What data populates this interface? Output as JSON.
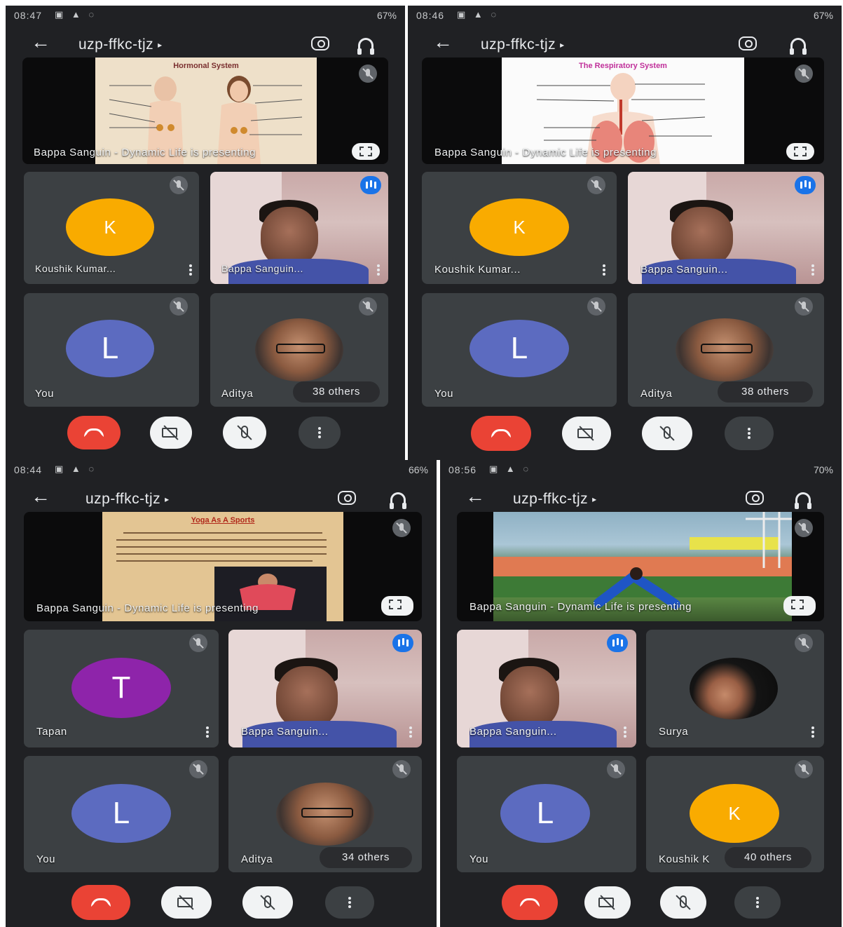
{
  "meeting": {
    "title": "uzp-ffkc-tjz",
    "presenter_caption": "Bappa Sanguin - Dynamic Life is presenting",
    "presenter_short": "Bappa Sanguin..."
  },
  "panels": [
    {
      "status": {
        "time": "08:47",
        "battery": "67%"
      },
      "slide": {
        "title": "Hormonal System"
      },
      "tiles": {
        "k_name": "Koushik Kumar...",
        "you_letter": "L",
        "you": "You",
        "aditya": "Aditya",
        "others": "38 others",
        "k_letter": "K"
      }
    },
    {
      "status": {
        "time": "08:46",
        "battery": "67%"
      },
      "slide": {
        "title": "The Respiratory System"
      },
      "tiles": {
        "k_name": "Koushik Kumar...",
        "you_letter": "L",
        "you": "You",
        "aditya": "Aditya",
        "others": "38 others",
        "k_letter": "K"
      }
    },
    {
      "status": {
        "time": "08:44",
        "battery": "66%"
      },
      "slide": {
        "title": "Yoga As A Sports"
      },
      "tiles": {
        "t_letter": "T",
        "t_name": "Tapan",
        "you_letter": "L",
        "you": "You",
        "aditya": "Aditya",
        "others": "34 others"
      }
    },
    {
      "status": {
        "time": "08:56",
        "battery": "70%"
      },
      "slide": {
        "title": ""
      },
      "tiles": {
        "surya": "Surya",
        "you_letter": "L",
        "you": "You",
        "k_letter": "K",
        "k_short": "Koushik K",
        "others": "40 others"
      }
    }
  ],
  "colors": {
    "bg": "#202124",
    "tile": "#3c4043",
    "end_call": "#ea4335",
    "avatar_k": "#f9ab00",
    "avatar_l": "#5c6bc0",
    "avatar_t": "#8e24aa",
    "speaking": "#1a73e8"
  }
}
